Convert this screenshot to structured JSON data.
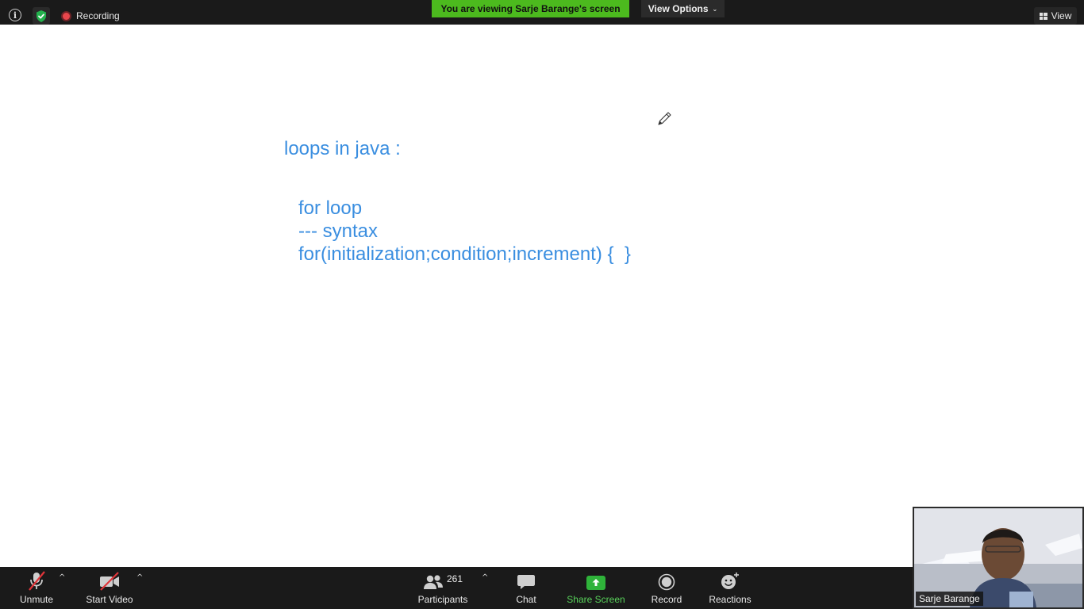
{
  "top_bar": {
    "recording_label": "Recording",
    "viewing_banner": "You are viewing Sarje Barange's screen",
    "view_options_label": "View Options",
    "view_label": "View",
    "colors": {
      "banner": "#4cba1e",
      "recording_dot": "#e8464c"
    }
  },
  "shared_screen": {
    "title": "loops in java :",
    "lines": [
      "for loop",
      "--- syntax",
      "for(initialization;condition;increment) {  }"
    ],
    "text_color": "#3a8ee0",
    "cursor_icon": "pencil-cursor-icon"
  },
  "toolbar": {
    "unmute_label": "Unmute",
    "start_video_label": "Start Video",
    "participants_label": "Participants",
    "participants_count": "261",
    "chat_label": "Chat",
    "share_screen_label": "Share Screen",
    "record_label": "Record",
    "reactions_label": "Reactions",
    "colors": {
      "share_screen": "#2fb33a",
      "muted_slash": "#e0353a"
    }
  },
  "self_video": {
    "name": "Sarje Barange"
  }
}
